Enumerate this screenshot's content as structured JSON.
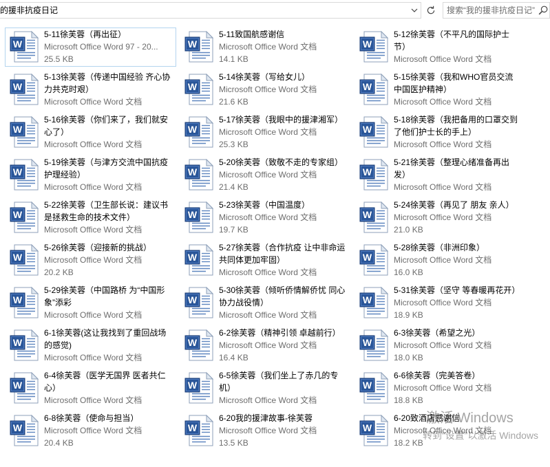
{
  "toolbar": {
    "address_text": "的援非抗疫日记",
    "search_placeholder": "搜索“我的援非抗疫日记”",
    "icons": {
      "address_dropdown": "chevron-down-icon",
      "refresh": "refresh-icon",
      "search": "search-icon"
    }
  },
  "file_icon": {
    "name": "word-document-icon",
    "badge_letter": "W",
    "badge_color": "#2a5699"
  },
  "files": [
    {
      "name": [
        "5-11徐芙蓉（再出征）"
      ],
      "type": "Microsoft Office Word 97 - 20...",
      "size": "25.5 KB",
      "focused": true
    },
    {
      "name": [
        "5-11致国航感谢信"
      ],
      "type": "Microsoft Office Word 文档",
      "size": "14.1 KB"
    },
    {
      "name": [
        "5-12徐芙蓉（不平凡的国际护士",
        "节）"
      ],
      "type": "Microsoft Office Word 文档"
    },
    {
      "name": [
        "5-13徐芙蓉（传递中国经验 齐心协",
        "力共克时艰）"
      ],
      "type": "Microsoft Office Word 文档"
    },
    {
      "name": [
        "5-14徐芙蓉（写给女儿）"
      ],
      "type": "Microsoft Office Word 文档",
      "size": "21.6 KB"
    },
    {
      "name": [
        "5-15徐芙蓉（我和WHO官员交流",
        "中国医护精神）"
      ],
      "type": "Microsoft Office Word 文档"
    },
    {
      "name": [
        "5-16徐芙蓉（你们来了，我们就安",
        "心了）"
      ],
      "type": "Microsoft Office Word 文档"
    },
    {
      "name": [
        "5-17徐芙蓉（我眼中的援津湘军）"
      ],
      "type": "Microsoft Office Word 文档",
      "size": "25.3 KB"
    },
    {
      "name": [
        "5-18徐芙蓉（我把备用的口罩交到",
        "了他们护士长的手上）"
      ],
      "type": "Microsoft Office Word 文档"
    },
    {
      "name": [
        "5-19徐芙蓉（与津方交流中国抗疫",
        "护理经验）"
      ],
      "type": "Microsoft Office Word 文档"
    },
    {
      "name": [
        "5-20徐芙蓉（致敬不走的专家组）"
      ],
      "type": "Microsoft Office Word 文档",
      "size": "21.4 KB"
    },
    {
      "name": [
        "5-21徐芙蓉（整理心绪准备再出",
        "发）"
      ],
      "type": "Microsoft Office Word 文档"
    },
    {
      "name": [
        "5-22徐芙蓉（卫生部长说：建议书",
        "是拯救生命的技术文件）"
      ],
      "type": "Microsoft Office Word 文档"
    },
    {
      "name": [
        "5-23徐芙蓉（中国温度）"
      ],
      "type": "Microsoft Office Word 文档",
      "size": "19.7 KB"
    },
    {
      "name": [
        "5-24徐芙蓉（再见了 朋友 亲人）"
      ],
      "type": "Microsoft Office Word 文档",
      "size": "21.0 KB"
    },
    {
      "name": [
        "5-26徐芙蓉（迎接新的挑战）"
      ],
      "type": "Microsoft Office Word 文档",
      "size": "20.2 KB"
    },
    {
      "name": [
        "5-27徐芙蓉（合作抗疫 让中非命运",
        "共同体更加牢固）"
      ],
      "type": "Microsoft Office Word 文档"
    },
    {
      "name": [
        "5-28徐芙蓉（非洲印象）"
      ],
      "type": "Microsoft Office Word 文档",
      "size": "16.0 KB"
    },
    {
      "name": [
        "5-29徐芙蓉（中国路桥 为“中国形",
        "象”添彩"
      ],
      "type": "Microsoft Office Word 文档"
    },
    {
      "name": [
        "5-30徐芙蓉（倾听侨情解侨忧 同心",
        "协力战役情）"
      ],
      "type": "Microsoft Office Word 文档"
    },
    {
      "name": [
        "5-31徐芙蓉（坚守 等春暖再花开）"
      ],
      "type": "Microsoft Office Word 文档",
      "size": "18.9 KB"
    },
    {
      "name": [
        "6-1徐芙蓉(这让我找到了重回战场",
        "的感觉)"
      ],
      "type": "Microsoft Office Word 文档"
    },
    {
      "name": [
        "6-2徐芙蓉（精神引领 卓越前行）"
      ],
      "type": "Microsoft Office Word 文档",
      "size": "16.4 KB"
    },
    {
      "name": [
        "6-3徐芙蓉（希望之光）"
      ],
      "type": "Microsoft Office Word 文档",
      "size": "18.0 KB"
    },
    {
      "name": [
        "6-4徐芙蓉（医学无国界 医者共仁",
        "心）"
      ],
      "type": "Microsoft Office Word 文档"
    },
    {
      "name": [
        "6-5徐芙蓉（我们坐上了赤几的专",
        "机）"
      ],
      "type": "Microsoft Office Word 文档"
    },
    {
      "name": [
        "6-6徐芙蓉（完美答卷）"
      ],
      "type": "Microsoft Office Word 文档",
      "size": "18.8 KB"
    },
    {
      "name": [
        "6-8徐芙蓉（使命与担当）"
      ],
      "type": "Microsoft Office Word 文档",
      "size": "20.4 KB"
    },
    {
      "name": [
        "6-20我的援津故事-徐芙蓉"
      ],
      "type": "Microsoft Office Word 文档",
      "size": "13.5 KB"
    },
    {
      "name": [
        "6-20致酒店感谢信"
      ],
      "type": "Microsoft Office Word 文档",
      "size": "18.2 KB"
    }
  ],
  "watermark": {
    "title": "激活 Windows",
    "message": "转到“设置”以激活 Windows"
  }
}
